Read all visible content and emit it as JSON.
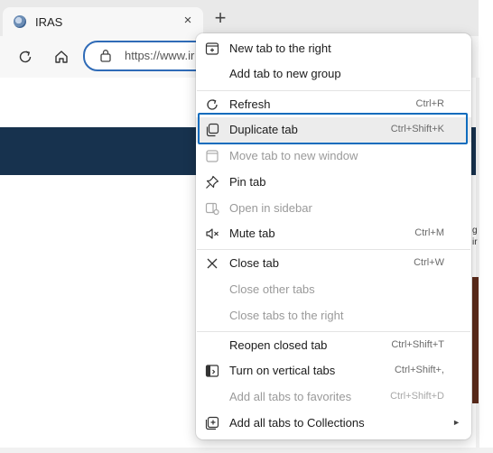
{
  "tab": {
    "title": "IRAS",
    "close_glyph": "×",
    "new_tab_glyph": "+"
  },
  "toolbar": {
    "url_prefix": "https://www.ir"
  },
  "menu": {
    "items": [
      {
        "label": "New tab to the right",
        "shortcut": "",
        "icon": "new-tab-icon",
        "disabled": false
      },
      {
        "label": "Add tab to new group",
        "shortcut": "",
        "icon": "",
        "disabled": false
      },
      {
        "label": "Refresh",
        "shortcut": "Ctrl+R",
        "icon": "refresh-icon",
        "disabled": false
      },
      {
        "label": "Duplicate tab",
        "shortcut": "Ctrl+Shift+K",
        "icon": "duplicate-icon",
        "disabled": false
      },
      {
        "label": "Move tab to new window",
        "shortcut": "",
        "icon": "window-icon",
        "disabled": true
      },
      {
        "label": "Pin tab",
        "shortcut": "",
        "icon": "pin-icon",
        "disabled": false
      },
      {
        "label": "Open in sidebar",
        "shortcut": "",
        "icon": "sidebar-icon",
        "disabled": true
      },
      {
        "label": "Mute tab",
        "shortcut": "Ctrl+M",
        "icon": "mute-icon",
        "disabled": false
      },
      {
        "label": "Close tab",
        "shortcut": "Ctrl+W",
        "icon": "close-icon",
        "disabled": false
      },
      {
        "label": "Close other tabs",
        "shortcut": "",
        "icon": "",
        "disabled": true
      },
      {
        "label": "Close tabs to the right",
        "shortcut": "",
        "icon": "",
        "disabled": true
      },
      {
        "label": "Reopen closed tab",
        "shortcut": "Ctrl+Shift+T",
        "icon": "",
        "disabled": false
      },
      {
        "label": "Turn on vertical tabs",
        "shortcut": "Ctrl+Shift+,",
        "icon": "vertical-tabs-icon",
        "disabled": false
      },
      {
        "label": "Add all tabs to favorites",
        "shortcut": "Ctrl+Shift+D",
        "icon": "",
        "disabled": true
      },
      {
        "label": "Add all tabs to Collections",
        "shortcut": "",
        "icon": "collections-icon",
        "disabled": false
      }
    ],
    "highlighted": "Duplicate tab",
    "submenu_arrow": "►"
  },
  "page_peek": {
    "line1": "g",
    "line2": "ir"
  },
  "colors": {
    "accent": "#0f6cbd",
    "banner": "#17324e",
    "chrome": "#e9e9e9"
  }
}
